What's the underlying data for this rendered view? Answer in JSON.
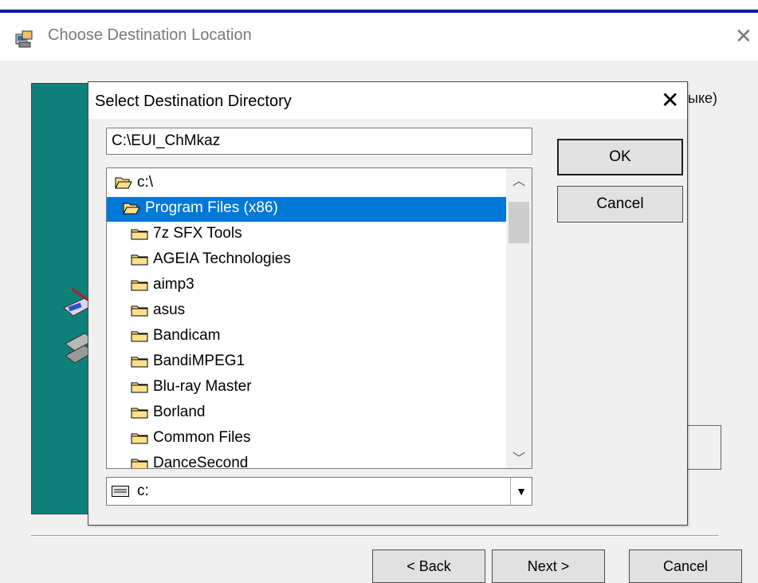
{
  "outer_window": {
    "title": "Choose Destination Location",
    "right_text_fragment": "ыке)",
    "buttons": {
      "back": "< Back",
      "next": "Next >",
      "cancel": "Cancel"
    }
  },
  "dialog": {
    "title": "Select Destination Directory",
    "path_value": "C:\\EUI_ChMkaz",
    "ok_label": "OK",
    "cancel_label": "Cancel",
    "folders": [
      {
        "label": "c:\\",
        "indent": 0,
        "open": true,
        "selected": false
      },
      {
        "label": "Program Files (x86)",
        "indent": 1,
        "open": true,
        "selected": true
      },
      {
        "label": "7z SFX Tools",
        "indent": 2,
        "open": false,
        "selected": false
      },
      {
        "label": "AGEIA Technologies",
        "indent": 2,
        "open": false,
        "selected": false
      },
      {
        "label": "aimp3",
        "indent": 2,
        "open": false,
        "selected": false
      },
      {
        "label": "asus",
        "indent": 2,
        "open": false,
        "selected": false
      },
      {
        "label": "Bandicam",
        "indent": 2,
        "open": false,
        "selected": false
      },
      {
        "label": "BandiMPEG1",
        "indent": 2,
        "open": false,
        "selected": false
      },
      {
        "label": "Blu-ray Master",
        "indent": 2,
        "open": false,
        "selected": false
      },
      {
        "label": "Borland",
        "indent": 2,
        "open": false,
        "selected": false
      },
      {
        "label": "Common Files",
        "indent": 2,
        "open": false,
        "selected": false
      },
      {
        "label": "DanceSecond",
        "indent": 2,
        "open": false,
        "selected": false
      }
    ],
    "drive": "c:"
  },
  "colors": {
    "selection": "#0078d7",
    "wizard_panel": "#0f7f7a",
    "title_strip": "#0b1a9c"
  }
}
